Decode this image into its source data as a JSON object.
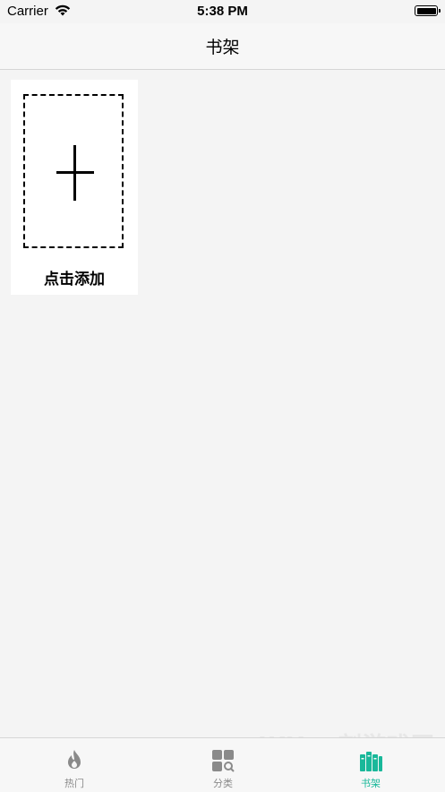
{
  "status_bar": {
    "carrier": "Carrier",
    "time": "5:38 PM"
  },
  "nav": {
    "title": "书架"
  },
  "shelf": {
    "add_label": "点击添加"
  },
  "tabs": [
    {
      "label": "热门",
      "icon": "flame-icon",
      "active": false
    },
    {
      "label": "分类",
      "icon": "category-search-icon",
      "active": false
    },
    {
      "label": "书架",
      "icon": "bookshelf-icon",
      "active": true
    }
  ],
  "watermark": {
    "main": "IKX 一刻游戏网",
    "sub": "www.ikyx.com"
  },
  "colors": {
    "accent": "#19b89a",
    "inactive": "#8a8a8a",
    "background": "#f4f4f4"
  }
}
